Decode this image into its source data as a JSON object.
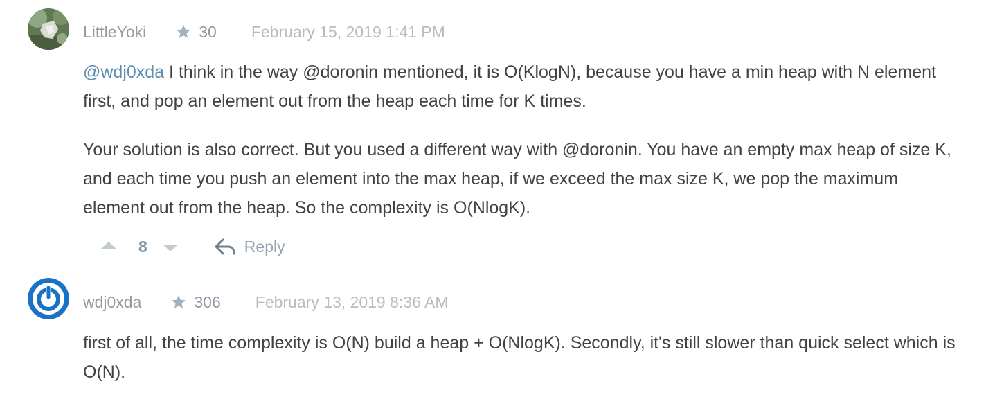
{
  "comments": [
    {
      "username": "LittleYoki",
      "reputation": "30",
      "timestamp": "February 15, 2019 1:41 PM",
      "body": {
        "p1_mention": "@wdj0xda",
        "p1_text": " I think in the way @doronin mentioned, it is O(KlogN), because you have a min heap with N element first, and pop an element out from the heap each time for K times.",
        "p2_text": "Your solution is also correct. But you used a different way with @doronin. You have an empty max heap of size K, and each time you push an element into the max heap, if we exceed the max size K, we pop the maximum element out from the heap. So the complexity is O(NlogK)."
      },
      "votes": "8",
      "reply_label": "Reply"
    },
    {
      "username": "wdj0xda",
      "reputation": "306",
      "timestamp": "February 13, 2019 8:36 AM",
      "body": {
        "p1_text": "first of all, the time complexity is O(N) build a heap + O(NlogK). Secondly, it's still slower than quick select which is O(N)."
      }
    }
  ],
  "icons": {
    "star": "star-icon",
    "upvote": "upvote-icon",
    "downvote": "downvote-icon",
    "reply": "reply-icon"
  },
  "colors": {
    "mention": "#5a8fb1",
    "username": "#959ba2",
    "timestamp": "#b4bcc4",
    "body_text": "#3f4346",
    "avatar_blue": "#1a72c6"
  }
}
